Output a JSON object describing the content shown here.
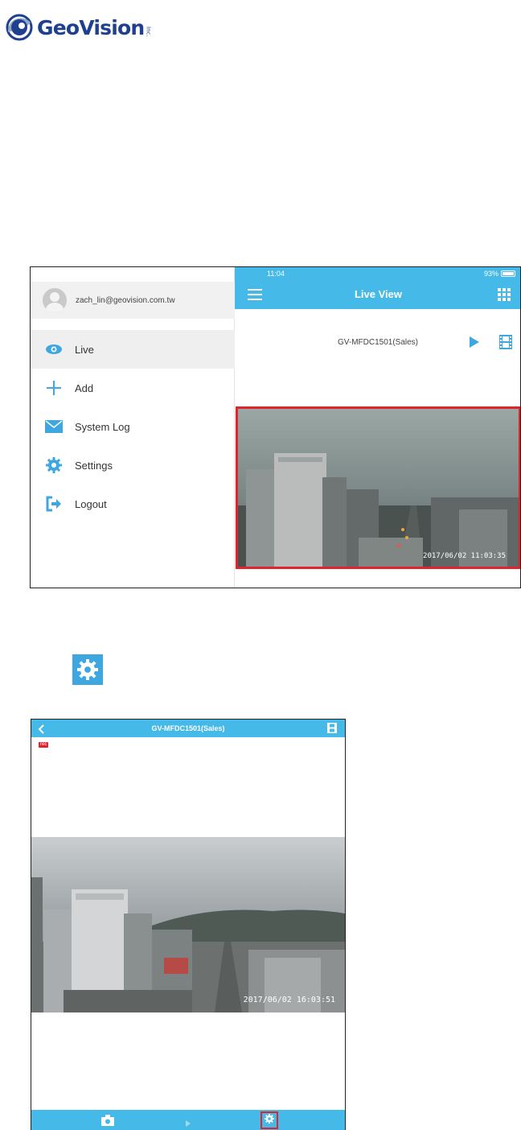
{
  "logo": {
    "text": "GeoVision",
    "inc": "Inc.",
    "color": "#1f3f8f"
  },
  "screenshot1": {
    "drawer": {
      "user_email": "zach_lin@geovision.com.tw",
      "items": [
        {
          "label": "Live",
          "icon": "eye-icon",
          "active": true
        },
        {
          "label": "Add",
          "icon": "plus-icon",
          "active": false
        },
        {
          "label": "System Log",
          "icon": "envelope-icon",
          "active": false
        },
        {
          "label": "Settings",
          "icon": "gear-icon",
          "active": false
        },
        {
          "label": "Logout",
          "icon": "logout-icon",
          "active": false
        }
      ]
    },
    "status_bar": {
      "time": "11:04",
      "battery": "93%"
    },
    "nav": {
      "title": "Live View"
    },
    "camera": {
      "name": "GV-MFDC1501(Sales)",
      "timestamp": "2017/06/02  11:03:35"
    }
  },
  "settings_icon": {
    "icon": "gear-icon"
  },
  "screenshot2": {
    "nav": {
      "title": "GV-MFDC1501(Sales)"
    },
    "rec_badge": "rec",
    "camera": {
      "timestamp": "2017/06/02  16:03:51"
    },
    "toolbar": {
      "items": [
        "snapshot-icon",
        "play-icon",
        "gear-icon"
      ]
    }
  },
  "colors": {
    "accent": "#45b9e7",
    "highlight": "#e2232b",
    "icon_blue": "#3fa7e0"
  }
}
